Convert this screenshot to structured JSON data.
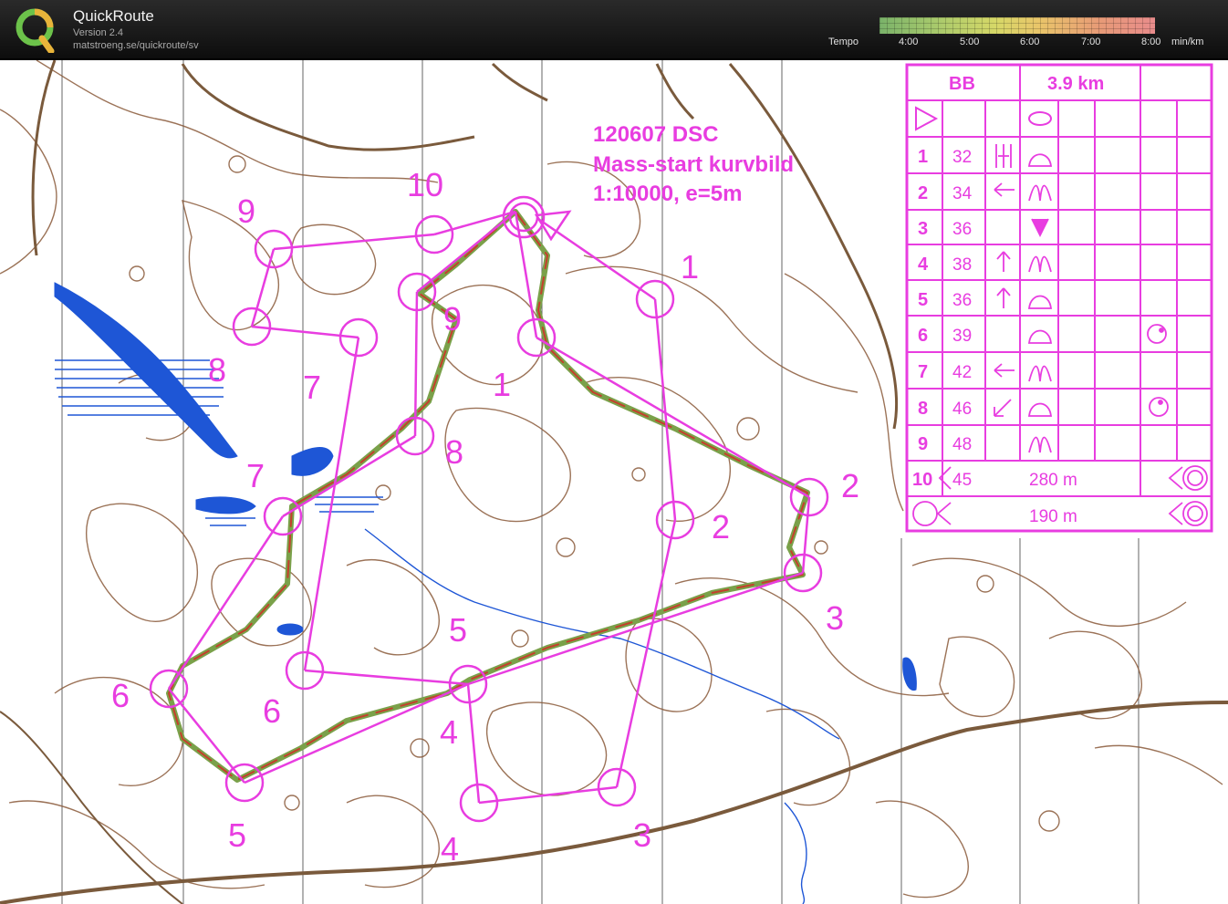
{
  "app": {
    "title": "QuickRoute",
    "version": "Version 2.4",
    "url": "matstroeng.se/quickroute/sv"
  },
  "tempo": {
    "label": "Tempo",
    "ticks": [
      "4:00",
      "5:00",
      "6:00",
      "7:00",
      "8:00"
    ],
    "unit": "min/km"
  },
  "map_info": {
    "line1": "120607 DSC",
    "line2": "Mass-start kurvbild",
    "line3": "1:10000, e=5m"
  },
  "description_sheet": {
    "class": "BB",
    "length": "3.9 km",
    "rows": [
      {
        "num": "1",
        "code": "32"
      },
      {
        "num": "2",
        "code": "34"
      },
      {
        "num": "3",
        "code": "36"
      },
      {
        "num": "4",
        "code": "38"
      },
      {
        "num": "5",
        "code": "36"
      },
      {
        "num": "6",
        "code": "39"
      },
      {
        "num": "7",
        "code": "42"
      },
      {
        "num": "8",
        "code": "46"
      },
      {
        "num": "9",
        "code": "48"
      },
      {
        "num": "10",
        "code": "45"
      }
    ],
    "row10_distance": "280 m",
    "finish_distance": "190 m"
  },
  "course_labels_outer": [
    "1",
    "2",
    "3",
    "4",
    "5",
    "6",
    "7",
    "8",
    "9",
    "10"
  ],
  "course_labels_inner": [
    "1",
    "2",
    "3",
    "4",
    "5",
    "6",
    "7",
    "8",
    "9"
  ],
  "colors": {
    "course": "#e83de0",
    "contour": "#8a5a3a",
    "water": "#1e56d6",
    "route_green": "#7aa14a",
    "route_red": "#c4402c"
  }
}
